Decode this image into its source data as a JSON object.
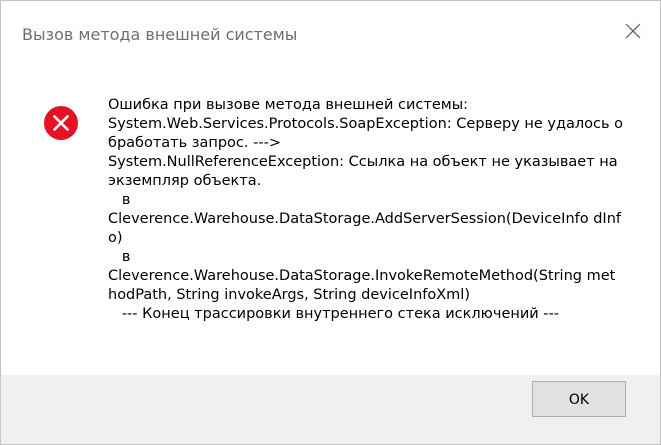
{
  "window": {
    "title": "Вызов метода внешней системы",
    "close_icon": "close-icon"
  },
  "dialog": {
    "icon": "error-icon",
    "icon_color": "#e81123",
    "message": "Ошибка при вызове метода внешней системы:\nSystem.Web.Services.Protocols.SoapException: Серверу не удалось обработать запрос. --->\nSystem.NullReferenceException: Ссылка на объект не указывает на экземпляр объекта.\n   в\nCleverence.Warehouse.DataStorage.AddServerSession(DeviceInfo dInfo)\n   в\nCleverence.Warehouse.DataStorage.InvokeRemoteMethod(String methodPath, String invokeArgs, String deviceInfoXml)\n   --- Конец трассировки внутреннего стека исключений ---"
  },
  "buttons": {
    "ok_label": "OK"
  }
}
